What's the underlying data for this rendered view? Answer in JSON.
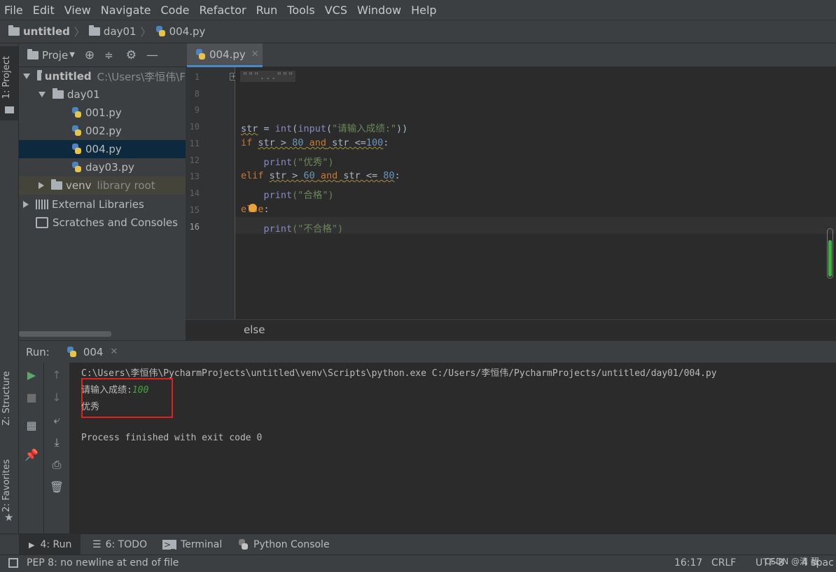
{
  "menu": [
    "File",
    "Edit",
    "View",
    "Navigate",
    "Code",
    "Refactor",
    "Run",
    "Tools",
    "VCS",
    "Window",
    "Help"
  ],
  "breadcrumb": {
    "project": "untitled",
    "folder": "day01",
    "file": "004.py"
  },
  "left_strip": {
    "project_tab": "1: Project",
    "structure_tab": "Z: Structure",
    "favorites_tab": "2: Favorites"
  },
  "project_panel": {
    "title": "Proje",
    "root_name": "untitled",
    "root_path": "C:\\Users\\李恒伟\\F",
    "folder": "day01",
    "files": [
      "001.py",
      "002.py",
      "004.py",
      "day03.py"
    ],
    "venv": "venv",
    "venv_note": "library root",
    "external": "External Libraries",
    "scratches": "Scratches and Consoles"
  },
  "editor": {
    "tab": "004.py",
    "line_numbers": [
      "1",
      "8",
      "9",
      "10",
      "11",
      "12",
      "13",
      "14",
      "15",
      "16"
    ],
    "folded": "\"\"\"...\"\"\"",
    "code": {
      "l10_var": "str",
      "l10_eq": " = ",
      "l10_int": "int",
      "l10_p1": "(",
      "l10_input": "input",
      "l10_p2": "(",
      "l10_str": "\"请输入成绩:\"",
      "l10_end": "))",
      "l11_if": "if",
      "l11_cond1": "str > ",
      "l11_n1": "80",
      "l11_and": "and",
      "l11_cond2": "str <=",
      "l11_n2": "100",
      "l11_colon": ":",
      "l12_print": "print",
      "l12_str": "(\"优秀\")",
      "l13_elif": "elif",
      "l13_cond1": "str > ",
      "l13_n1": "60",
      "l13_and": "and",
      "l13_cond2": "str <= ",
      "l13_n2": "80",
      "l13_colon": ":",
      "l14_print": "print",
      "l14_str": "(\"合格\")",
      "l15_else": "else",
      "l15_colon": ":",
      "l16_print": "print",
      "l16_str": "(\"不合格\")"
    },
    "breadcrumb_line": "else"
  },
  "run_panel": {
    "label": "Run:",
    "tab": "004",
    "cmd": "C:\\Users\\李恒伟\\PycharmProjects\\untitled\\venv\\Scripts\\python.exe C:/Users/李恒伟/PycharmProjects/untitled/day01/004.py",
    "prompt": "请输入成绩:",
    "input_value": "100",
    "output": "优秀",
    "finished": "Process finished with exit code 0"
  },
  "bottom_tabs": [
    "4: Run",
    "6: TODO",
    "Terminal",
    "Python Console"
  ],
  "status": {
    "message": "PEP 8: no newline at end of file",
    "position": "16:17",
    "line_sep": "CRLF",
    "encoding": "UTF-8",
    "indent": "4 spac",
    "watermark": "CSDN @清 醒"
  }
}
